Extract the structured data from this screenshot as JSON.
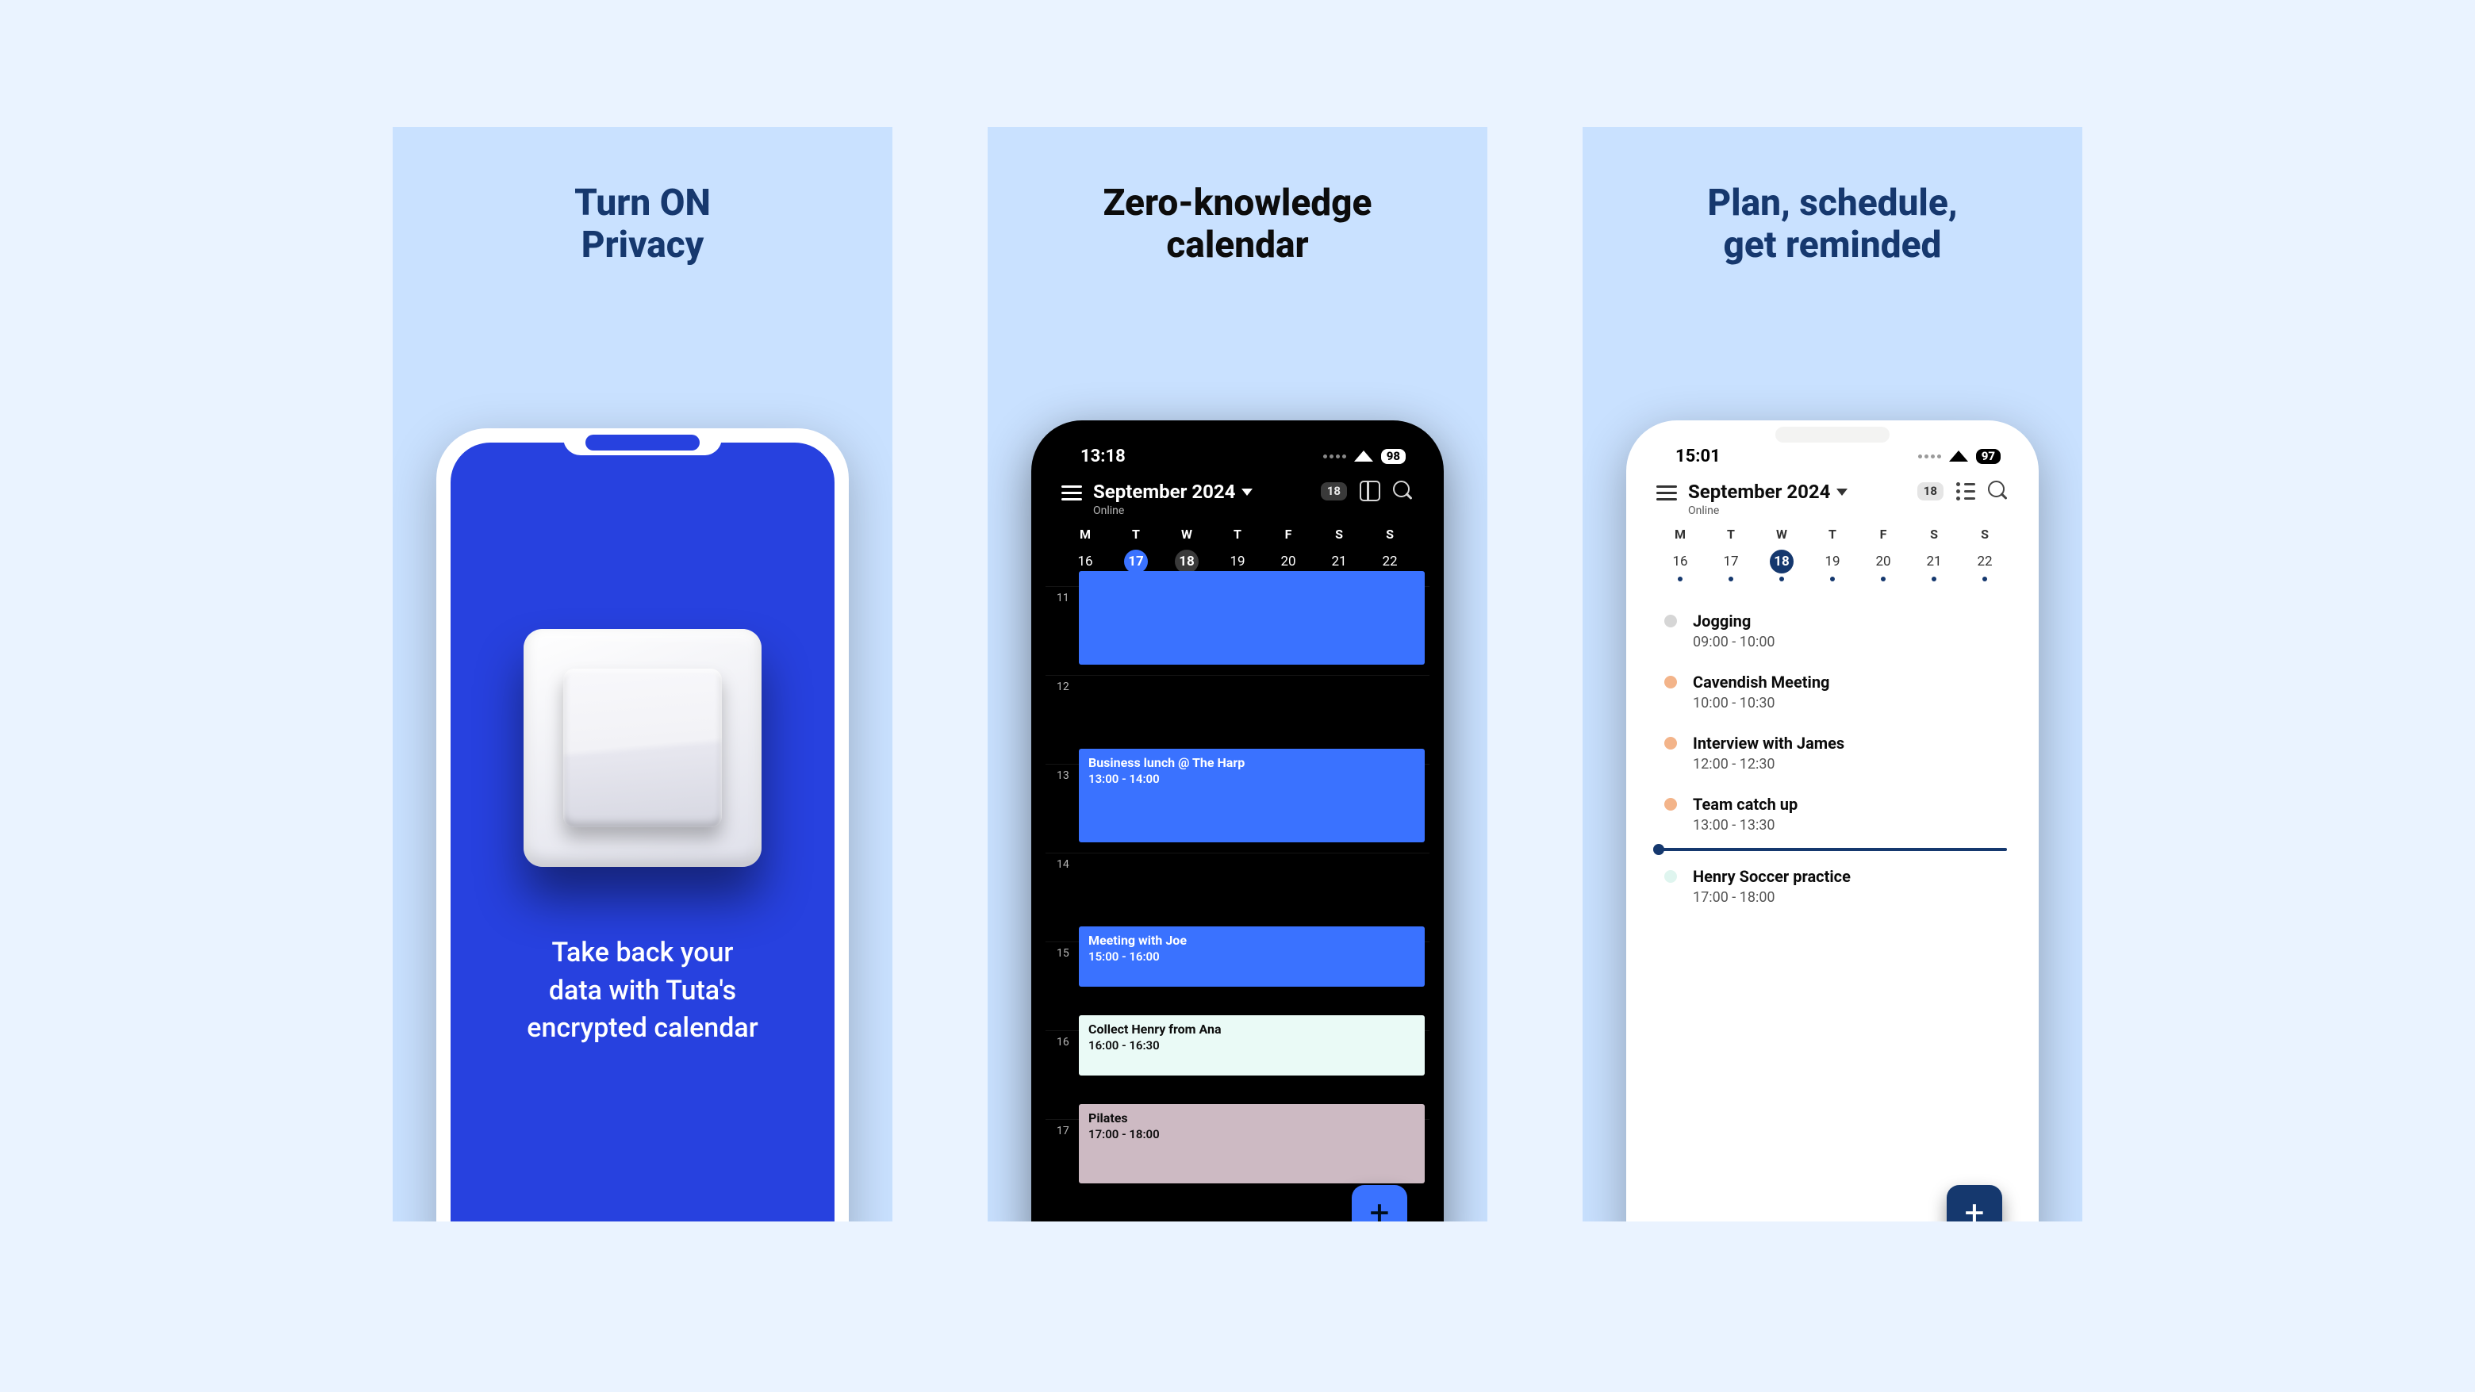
{
  "panel1": {
    "title_line1": "Turn ON",
    "title_line2": "Privacy",
    "caption_line1": "Take back your",
    "caption_line2": "data with Tuta's",
    "caption_line3": "encrypted calendar"
  },
  "panel2": {
    "title_line1": "Zero-knowledge",
    "title_line2": "calendar",
    "status_time": "13:18",
    "battery": "98",
    "month": "September 2024",
    "status_sub": "Online",
    "today_pill": "18",
    "weekdays": [
      "M",
      "T",
      "W",
      "T",
      "F",
      "S",
      "S"
    ],
    "daynums": [
      "16",
      "17",
      "18",
      "19",
      "20",
      "21",
      "22"
    ],
    "today_index": 1,
    "alt_index": 2,
    "hours": [
      "11",
      "12",
      "13",
      "14",
      "15",
      "16",
      "17"
    ],
    "events": {
      "h13": {
        "title": "Business lunch @ The Harp",
        "time": "13:00 - 14:00"
      },
      "h15": {
        "title": "Meeting with Joe",
        "time": "15:00 - 16:00"
      },
      "h16": {
        "title": "Collect Henry from Ana",
        "time": "16:00 - 16:30"
      },
      "h17": {
        "title": "Pilates",
        "time": "17:00 - 18:00"
      }
    },
    "fab": "+"
  },
  "panel3": {
    "title_line1": "Plan, schedule,",
    "title_line2": "get reminded",
    "status_time": "15:01",
    "battery": "97",
    "month": "September 2024",
    "status_sub": "Online",
    "today_pill": "18",
    "weekdays": [
      "M",
      "T",
      "W",
      "T",
      "F",
      "S",
      "S"
    ],
    "daynums": [
      "16",
      "17",
      "18",
      "19",
      "20",
      "21",
      "22"
    ],
    "today_index": 2,
    "agenda": [
      {
        "title": "Jogging",
        "time": "09:00 - 10:00",
        "dot": "#d6d6d6"
      },
      {
        "title": "Cavendish Meeting",
        "time": "10:00 - 10:30",
        "dot": "#f3b48a"
      },
      {
        "title": "Interview with James",
        "time": "12:00 - 12:30",
        "dot": "#f3b48a"
      },
      {
        "title": "Team catch up",
        "time": "13:00 - 13:30",
        "dot": "#f3b48a"
      },
      {
        "title": "Henry Soccer practice",
        "time": "17:00 - 18:00",
        "dot": "#dff5ef"
      }
    ],
    "fab": "+"
  }
}
